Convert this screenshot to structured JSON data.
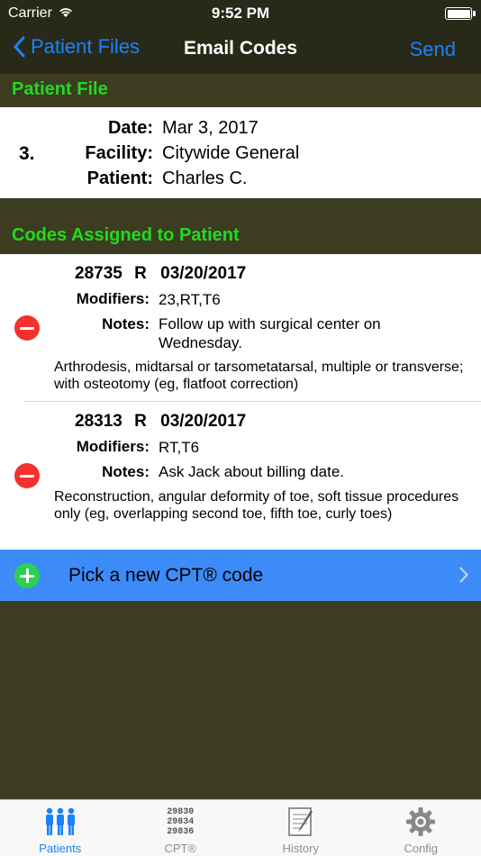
{
  "status_bar": {
    "carrier": "Carrier",
    "time": "9:52 PM"
  },
  "nav": {
    "back_label": "Patient Files",
    "title": "Email Codes",
    "send_label": "Send"
  },
  "patient_file": {
    "section_title": "Patient File",
    "number": "3.",
    "fields": [
      {
        "label": "Date:",
        "value": "Mar 3, 2017"
      },
      {
        "label": "Facility:",
        "value": "Citywide General"
      },
      {
        "label": "Patient:",
        "value": "Charles C."
      }
    ]
  },
  "codes": {
    "section_title": "Codes Assigned to Patient",
    "items": [
      {
        "code": "28735",
        "side": "R",
        "date": "03/20/2017",
        "modifiers_label": "Modifiers:",
        "modifiers": "23,RT,T6",
        "notes_label": "Notes:",
        "notes": "Follow up with surgical center on Wednesday.",
        "description": "Arthrodesis, midtarsal or tarsometatarsal, multiple or transverse; with osteotomy (eg, flatfoot correction)"
      },
      {
        "code": "28313",
        "side": "R",
        "date": "03/20/2017",
        "modifiers_label": "Modifiers:",
        "modifiers": "RT,T6",
        "notes_label": "Notes:",
        "notes": "Ask Jack about billing date.",
        "description": "Reconstruction, angular deformity of toe, soft tissue procedures only (eg, overlapping second toe, fifth toe, curly toes)"
      }
    ],
    "pick_label": "Pick a new CPT® code"
  },
  "tabs": [
    {
      "label": "Patients",
      "icon": "patients-icon",
      "active": true
    },
    {
      "label": "CPT®",
      "icon": "cpt-icon",
      "active": false,
      "icon_text": [
        "29830",
        "29834",
        "29836"
      ]
    },
    {
      "label": "History",
      "icon": "history-icon",
      "active": false
    },
    {
      "label": "Config",
      "icon": "gear-icon",
      "active": false
    }
  ],
  "colors": {
    "background": "#3c3c21",
    "nav_background": "#29291a",
    "section_header_text": "#1edc1e",
    "accent_blue": "#1a82fb",
    "pick_row": "#3d8bf8",
    "remove_red": "#f62f2f",
    "add_green": "#2cd050"
  }
}
